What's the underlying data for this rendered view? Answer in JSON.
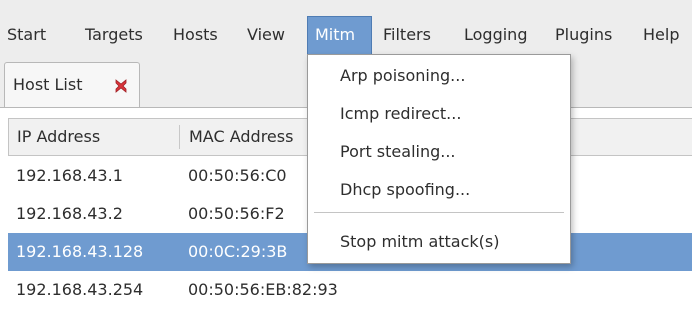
{
  "menubar": {
    "items": [
      {
        "label": "Start"
      },
      {
        "label": "Targets"
      },
      {
        "label": "Hosts"
      },
      {
        "label": "View"
      },
      {
        "label": "Mitm"
      },
      {
        "label": "Filters"
      },
      {
        "label": "Logging"
      },
      {
        "label": "Plugins"
      },
      {
        "label": "Help"
      }
    ],
    "active": "Mitm"
  },
  "tab": {
    "label": "Host List",
    "close_icon": "close-icon"
  },
  "table": {
    "columns": [
      "IP Address",
      "MAC Address"
    ],
    "rows": [
      {
        "ip": "192.168.43.1",
        "mac": "00:50:56:C0"
      },
      {
        "ip": "192.168.43.2",
        "mac": "00:50:56:F2"
      },
      {
        "ip": "192.168.43.128",
        "mac": "00:0C:29:3B"
      },
      {
        "ip": "192.168.43.254",
        "mac": "00:50:56:EB:82:93"
      }
    ],
    "selected_row": 2
  },
  "mitm_menu": {
    "items": [
      {
        "label": "Arp poisoning..."
      },
      {
        "label": "Icmp redirect..."
      },
      {
        "label": "Port stealing..."
      },
      {
        "label": "Dhcp spoofing..."
      },
      {
        "label": "Stop mitm attack(s)"
      }
    ]
  },
  "colors": {
    "selection": "#6f9bd0",
    "menubar_bg": "#ededed",
    "close_icon": "#d9343a"
  }
}
